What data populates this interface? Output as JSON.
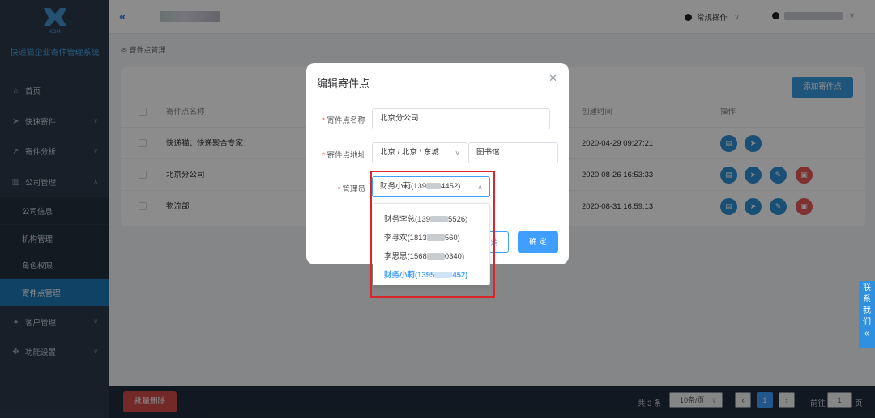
{
  "sidebar": {
    "brand": "快递猫企业寄件管理系统",
    "menu": [
      {
        "label": "首页",
        "icon": "home-icon",
        "glyph": "⌂"
      },
      {
        "label": "快速寄件",
        "icon": "send-icon",
        "glyph": "➤"
      },
      {
        "label": "寄件分析",
        "icon": "chart-icon",
        "glyph": "↗"
      },
      {
        "label": "公司管理",
        "icon": "building-icon",
        "glyph": "▥"
      },
      {
        "label": "客户管理",
        "icon": "user-icon",
        "glyph": "●"
      },
      {
        "label": "功能设置",
        "icon": "settings-icon",
        "glyph": "✥"
      }
    ],
    "submenu": [
      "公司信息",
      "机构管理",
      "角色权限",
      "寄件点管理"
    ]
  },
  "header": {
    "mode_label": "常规操作"
  },
  "breadcrumb": "寄件点管理",
  "add_button": "添加寄件点",
  "table": {
    "headers": {
      "name": "寄件点名称",
      "created": "创建时间",
      "actions": "操作"
    },
    "rows": [
      {
        "name": "快递猫：快递聚合专家！",
        "created": "2020-04-29 09:27:21"
      },
      {
        "name": "北京分公司",
        "created": "2020-08-26 16:53:33"
      },
      {
        "name": "物流部",
        "created": "2020-08-31 16:59:13"
      }
    ]
  },
  "dialog": {
    "title": "编辑寄件点",
    "name_label": "寄件点名称",
    "name_value": "北京分公司",
    "address_label": "寄件点地址",
    "region_value": "北京 / 北京 / 东城",
    "address_value": "图书馆",
    "manager_label": "管理员",
    "manager_value_prefix": "财务小莉(139",
    "manager_value_suffix": "4452)",
    "cancel_partial": "消",
    "confirm_label": "确 定"
  },
  "dropdown": {
    "options": [
      {
        "prefix": "财务李总(139",
        "suffix": "5526)"
      },
      {
        "prefix": "李寻欢(1813",
        "suffix": "560)"
      },
      {
        "prefix": "李思思(1568",
        "suffix": "0340)"
      },
      {
        "prefix": "财务小莉(1395",
        "suffix": "452)"
      }
    ]
  },
  "footer": {
    "bulk_delete": "批量删除",
    "total": "共 3 条",
    "page_size": "10条/页",
    "prev": "‹",
    "current_page": "1",
    "next": "›",
    "goto_label": "前往",
    "goto_value": "1",
    "page_unit": "页"
  },
  "contact_tab": [
    "联",
    "系",
    "我",
    "们",
    "«"
  ]
}
